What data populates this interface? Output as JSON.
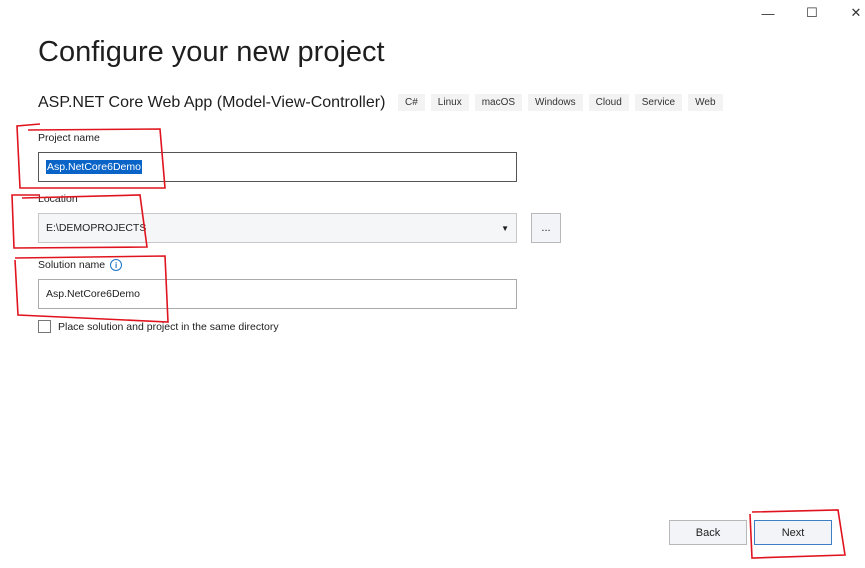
{
  "window": {
    "minimize": "—",
    "maximize": "☐",
    "close": "✕"
  },
  "title": "Configure your new project",
  "template_name": "ASP.NET Core Web App (Model-View-Controller)",
  "tags": [
    "C#",
    "Linux",
    "macOS",
    "Windows",
    "Cloud",
    "Service",
    "Web"
  ],
  "project_name": {
    "label": "Project name",
    "value": "Asp.NetCore6Demo"
  },
  "location": {
    "label": "Location",
    "value": "E:\\DEMOPROJECTS",
    "browse": "..."
  },
  "solution_name": {
    "label": "Solution name",
    "value": "Asp.NetCore6Demo",
    "info": "i"
  },
  "same_dir": {
    "label": "Place solution and project in the same directory",
    "checked": false
  },
  "buttons": {
    "back": "Back",
    "next": "Next"
  }
}
